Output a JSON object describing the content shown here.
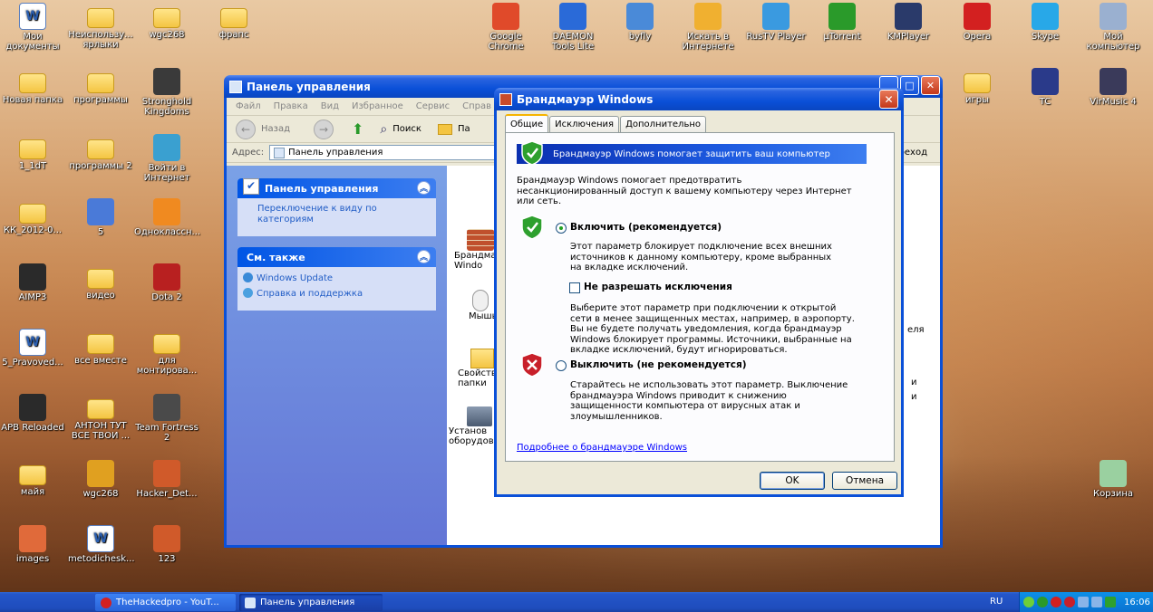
{
  "desktop": {
    "icons": [
      {
        "label": "Мои документы"
      },
      {
        "label": "Неиспользу... ярлыки"
      },
      {
        "label": "wgc268"
      },
      {
        "label": "фрапс"
      },
      {
        "label": "Google Chrome"
      },
      {
        "label": "DAEMON Tools Lite"
      },
      {
        "label": "byfly"
      },
      {
        "label": "Искать в Интернете"
      },
      {
        "label": "RusTV Player"
      },
      {
        "label": "µTorrent"
      },
      {
        "label": "KMPlayer"
      },
      {
        "label": "Opera"
      },
      {
        "label": "Skype"
      },
      {
        "label": "Мой компьютер"
      },
      {
        "label": "Новая папка"
      },
      {
        "label": "программы"
      },
      {
        "label": "Stronghold Kingdoms"
      },
      {
        "label": "игры"
      },
      {
        "label": "TC"
      },
      {
        "label": "VirMusic 4"
      },
      {
        "label": "1_1dT"
      },
      {
        "label": "программы 2"
      },
      {
        "label": "Войти в Интернет"
      },
      {
        "label": "КК_2012-0..."
      },
      {
        "label": "5"
      },
      {
        "label": "Одноклассн..."
      },
      {
        "label": "AIMP3"
      },
      {
        "label": "видео"
      },
      {
        "label": "Dota 2"
      },
      {
        "label": "5_Pravoved..."
      },
      {
        "label": "все вместе"
      },
      {
        "label": "для монтирова..."
      },
      {
        "label": "APB Reloaded"
      },
      {
        "label": "АНТОН ТУТ ВСЕ ТВОИ ..."
      },
      {
        "label": "Team Fortress 2"
      },
      {
        "label": "майя"
      },
      {
        "label": "wgc268"
      },
      {
        "label": "Hacker_Det..."
      },
      {
        "label": "Корзина"
      },
      {
        "label": "images"
      },
      {
        "label": "metodichesk..."
      },
      {
        "label": "123"
      }
    ]
  },
  "control_panel": {
    "title": "Панель управления",
    "menu": [
      "Файл",
      "Правка",
      "Вид",
      "Избранное",
      "Сервис",
      "Справ"
    ],
    "toolbar": {
      "back": "Назад",
      "search": "Поиск",
      "folders": "Па"
    },
    "address_label": "Адрес:",
    "address_value": "Панель управления",
    "go_label": "реход",
    "side": {
      "panel_title": "Панель управления",
      "switch_view": "Переключение к виду по категориям",
      "see_also": "См. также",
      "links": [
        "Windows Update",
        "Справка и поддержка"
      ]
    },
    "items": [
      {
        "label": "Брандма Windo"
      },
      {
        "label": "Мышь"
      },
      {
        "label": "Свойства папки"
      },
      {
        "label": "Установ оборудова"
      }
    ],
    "right_fragments": [
      "еля",
      "и",
      "и"
    ]
  },
  "firewall_dialog": {
    "title": "Брандмауэр Windows",
    "tabs": [
      "Общие",
      "Исключения",
      "Дополнительно"
    ],
    "banner": "Брандмауэр Windows помогает защитить ваш компьютер",
    "intro": "Брандмауэр Windows помогает предотвратить несанкционированный доступ к вашему компьютеру через Интернет или сеть.",
    "on_label": "Включить (рекомендуется)",
    "on_desc": "Этот параметр блокирует подключение всех внешних источников к данному компьютеру, кроме выбранных на вкладке исключений.",
    "no_exceptions_label": "Не разрешать исключения",
    "no_exceptions_desc": "Выберите этот параметр при подключении к открытой сети в менее защищенных местах, например, в аэропорту. Вы не будете получать уведомления, когда брандмауэр Windows блокирует программы. Источники, выбранные на вкладке исключений, будут игнорироваться.",
    "off_label": "Выключить (не рекомендуется)",
    "off_desc": "Старайтесь не использовать этот параметр. Выключение брандмауэра Windows приводит к снижению защищенности компьютера от вирусных атак и злоумышленников.",
    "more_link": "Подробнее о брандмауэре Windows",
    "ok": "OK",
    "cancel": "Отмена"
  },
  "taskbar": {
    "tasks": [
      "TheHackedpro - YouT...",
      "Панель управления"
    ],
    "lang": "RU",
    "clock": "16:06"
  }
}
